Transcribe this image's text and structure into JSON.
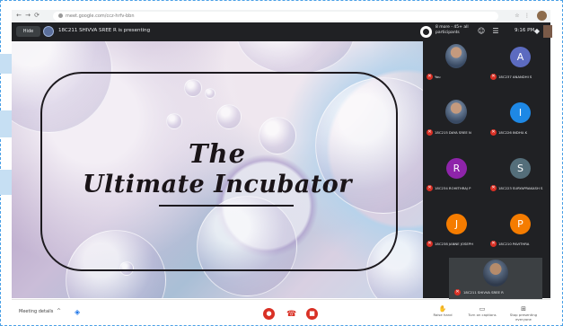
{
  "browser": {
    "url": "meet.google.com/ccz-hrfv-bbn",
    "nav": [
      "←",
      "→",
      "⟳"
    ],
    "controls": [
      "☆",
      "⋮"
    ]
  },
  "topbar": {
    "hide_label": "Hide",
    "presenting_text": "18C211 SHIVVA SREE R is presenting",
    "recording_label": "8 more - 45+ all participants",
    "clock": "9:16 PM",
    "icons": [
      "people-icon",
      "chat-icon",
      "activities-icon"
    ]
  },
  "slide": {
    "line1": "The",
    "line2": "Ultimate Incubator"
  },
  "participants": [
    {
      "name": "You",
      "initial": "",
      "color": "",
      "photo": true
    },
    {
      "name": "18C237 ANANDHI S",
      "initial": "A",
      "color": "#5c6bc0",
      "photo": false
    },
    {
      "name": "18C215 DAYA SREE N",
      "initial": "",
      "color": "",
      "photo": true
    },
    {
      "name": "18C226 INDHU.K",
      "initial": "I",
      "color": "#1e88e5",
      "photo": false
    },
    {
      "name": "18C234 ROHITHRAJ P",
      "initial": "R",
      "color": "#8e24aa",
      "photo": false
    },
    {
      "name": "18C223 SURYAPRAKASH S",
      "initial": "S",
      "color": "#546e7a",
      "photo": false
    },
    {
      "name": "18C238 JANNE JOSEPH",
      "initial": "J",
      "color": "#f57c00",
      "photo": false
    },
    {
      "name": "18C210 PAVITHRA",
      "initial": "P",
      "color": "#f57c00",
      "photo": false
    }
  ],
  "self_tile": {
    "name": "18C211 SHIVVA SREE R"
  },
  "bottom": {
    "meeting_code": "Meeting details",
    "dropdown": "^",
    "right_buttons": [
      {
        "icon": "✋",
        "label": "Raise hand"
      },
      {
        "icon": "▭",
        "label": "Turn on captions"
      },
      {
        "icon": "⊞",
        "label": "Stop presenting everyone"
      }
    ]
  }
}
